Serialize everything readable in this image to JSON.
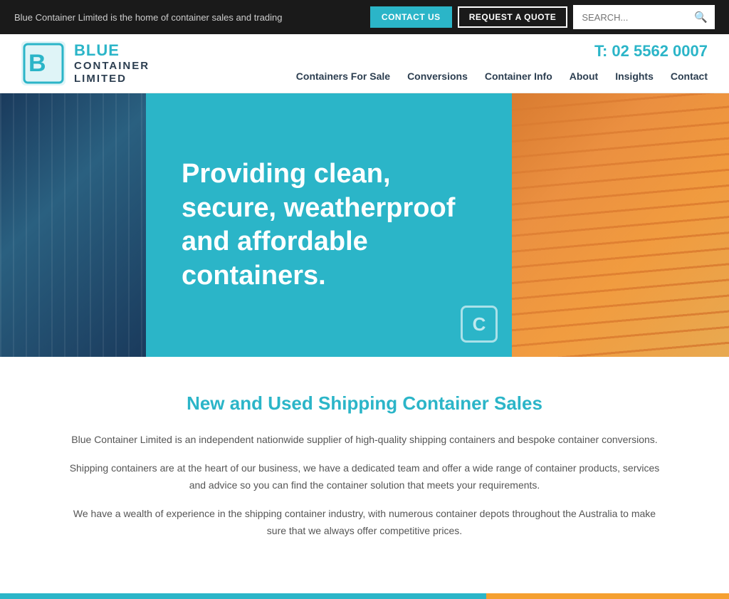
{
  "topbar": {
    "tagline": "Blue Container Limited is the home of container sales and trading",
    "contact_label": "CONTACT US",
    "quote_label": "REQUEST A QUOTE",
    "search_placeholder": "SEARCH..."
  },
  "header": {
    "logo_blue": "BLUE",
    "logo_container": "CONTAINER",
    "logo_limited": "LIMITED",
    "phone": "T: 02 5562 0007"
  },
  "nav": {
    "items": [
      {
        "label": "Containers For Sale"
      },
      {
        "label": "Conversions"
      },
      {
        "label": "Container Info"
      },
      {
        "label": "About"
      },
      {
        "label": "Insights"
      },
      {
        "label": "Contact"
      }
    ]
  },
  "hero": {
    "heading": "Providing clean, secure, weatherproof and affordable containers."
  },
  "main": {
    "section_title": "New and Used Shipping Container Sales",
    "para1": "Blue Container Limited is an independent nationwide supplier of high-quality shipping containers and bespoke container conversions.",
    "para2": "Shipping containers are at the heart of our business, we have a dedicated team and offer a wide range of container products, services and advice so you can find the container solution that meets your requirements.",
    "para3": "We have a wealth of experience in the shipping container industry, with numerous container depots throughout the Australia to make sure that we always offer competitive prices."
  }
}
